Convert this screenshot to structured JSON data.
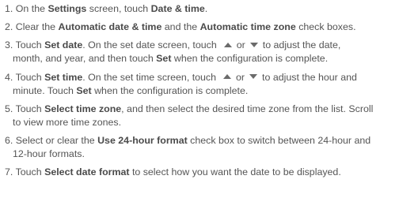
{
  "steps": [
    {
      "num": "1.",
      "t1": "On the ",
      "b1": "Settings",
      "t2": " screen, touch ",
      "b2": "Date & time",
      "t3": "."
    },
    {
      "num": "2.",
      "t1": "Clear the ",
      "b1": "Automatic date & time",
      "t2": " and the ",
      "b2": "Automatic time zone",
      "t3": " check boxes."
    },
    {
      "num": "3.",
      "t1": "Touch ",
      "b1": "Set date",
      "t2": ". On the set date screen, touch",
      "t3": "or",
      "t4": "to adjust the date,",
      "t5": "month, and year, and then touch ",
      "b2": "Set",
      "t6": " when the configuration is complete."
    },
    {
      "num": "4.",
      "t1": "Touch ",
      "b1": "Set time",
      "t2": ". On the set time screen, touch",
      "t3": "or",
      "t4": "to adjust the hour and",
      "t5": "minute. Touch ",
      "b2": "Set",
      "t6": " when the configuration is complete."
    },
    {
      "num": "5.",
      "t1": "Touch ",
      "b1": "Select time zone",
      "t2": ", and then select the desired time zone from the list. Scroll",
      "t3": "to view more time zones."
    },
    {
      "num": "6.",
      "t1": "Select or clear the ",
      "b1": "Use 24-hour format",
      "t2": " check box to switch between 24-hour and",
      "t3": "12-hour formats."
    },
    {
      "num": "7.",
      "t1": "Touch ",
      "b1": "Select date format",
      "t2": " to select how you want the date to be displayed."
    }
  ],
  "icons": {
    "up": "triangle-up-icon",
    "down": "triangle-down-icon"
  }
}
